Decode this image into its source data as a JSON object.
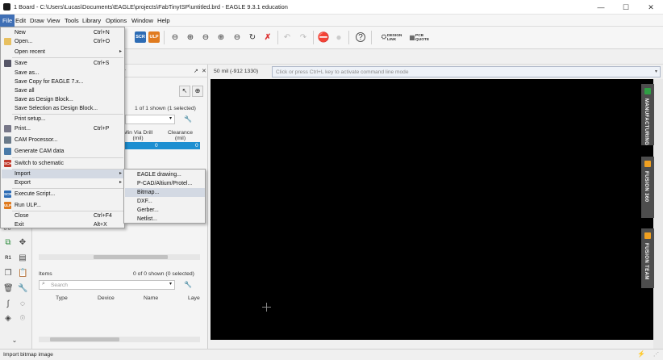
{
  "window": {
    "title": "1 Board - C:\\Users\\Lucas\\Documents\\EAGLE\\projects\\FabTinyISP\\untitled.brd - EAGLE 9.3.1 education",
    "minimize": "—",
    "maximize": "☐",
    "close": "✕"
  },
  "menubar": [
    "File",
    "Edit",
    "Draw",
    "View",
    "Tools",
    "Library",
    "Options",
    "Window",
    "Help"
  ],
  "toolbar": {
    "scr_badge": "SCR",
    "ulp_badge": "ULP",
    "design_link": "DESIGN\nLINK",
    "pcb_quote": "PCB\nQUOTE"
  },
  "panel": {
    "tab_suffix": "ger",
    "top_count": "1 of 1 shown (1 selected)",
    "col_min_via": "Min Via Drill\n(mil)",
    "col_clearance": "Clearance\n(mil)",
    "row_val1": "0",
    "row_val2": "0",
    "items_label": "Items",
    "bottom_count": "0 of 0 shown (0 selected)",
    "search_placeholder": "Search",
    "cols": [
      "Type",
      "Device",
      "Name",
      "Laye"
    ]
  },
  "canvas": {
    "coord": "50 mil (-912 1330)",
    "cmd_placeholder": "Click or press Ctrl+L key to activate command line mode"
  },
  "right_tabs": [
    {
      "label": "MANUFACTURING",
      "color": "#2f9e44"
    },
    {
      "label": "FUSION 360",
      "color": "#f0a020"
    },
    {
      "label": "FUSION TEAM",
      "color": "#f0a020"
    }
  ],
  "status": "Import bitmap image",
  "file_menu": {
    "items": [
      {
        "label": "New",
        "shortcut": "Ctrl+N"
      },
      {
        "label": "Open...",
        "shortcut": "Ctrl+O"
      },
      {
        "label": "Open recent",
        "shortcut": ""
      },
      {
        "label": "Save",
        "shortcut": "Ctrl+S"
      },
      {
        "label": "Save as...",
        "shortcut": ""
      },
      {
        "label": "Save Copy for EAGLE 7.x...",
        "shortcut": ""
      },
      {
        "label": "Save all",
        "shortcut": ""
      },
      {
        "label": "Save as Design Block...",
        "shortcut": ""
      },
      {
        "label": "Save Selection as Design Block...",
        "shortcut": ""
      },
      {
        "label": "Print setup...",
        "shortcut": ""
      },
      {
        "label": "Print...",
        "shortcut": "Ctrl+P"
      },
      {
        "label": "CAM Processor...",
        "shortcut": ""
      },
      {
        "label": "Generate CAM data",
        "shortcut": ""
      },
      {
        "label": "Switch to schematic",
        "shortcut": ""
      },
      {
        "label": "Import",
        "shortcut": ""
      },
      {
        "label": "Export",
        "shortcut": ""
      },
      {
        "label": "Execute Script...",
        "shortcut": ""
      },
      {
        "label": "Run ULP...",
        "shortcut": ""
      },
      {
        "label": "Close",
        "shortcut": "Ctrl+F4"
      },
      {
        "label": "Exit",
        "shortcut": "Alt+X"
      }
    ],
    "icon_scr": "SCR",
    "icon_ulp": "ULP",
    "icon_sch": "SCH"
  },
  "import_submenu": [
    "EAGLE drawing...",
    "P-CAD/Altium/Protel...",
    "Bitmap...",
    "DXF...",
    "Gerber...",
    "Netlist..."
  ],
  "left_strip_labels": {
    "r1": "R1",
    "val": "0 0"
  }
}
